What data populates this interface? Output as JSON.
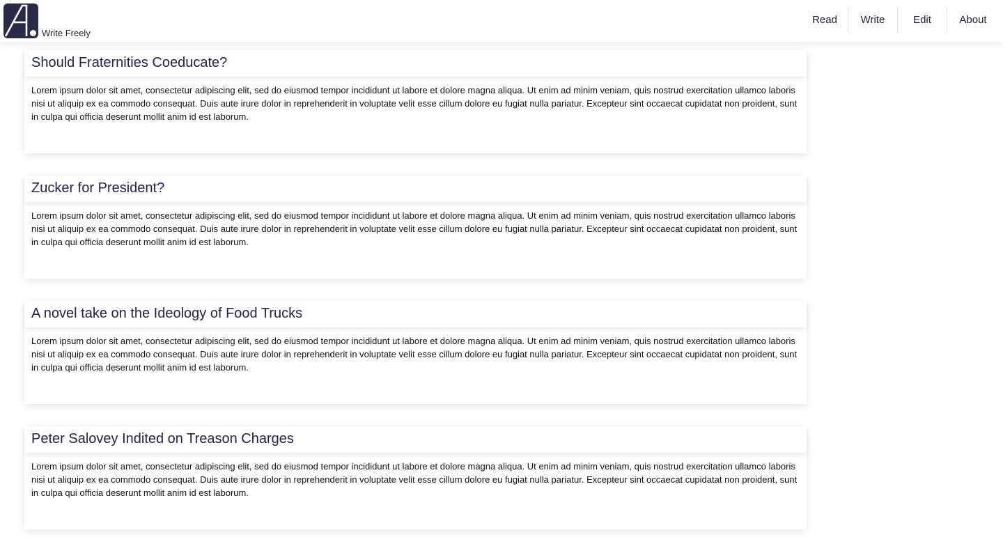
{
  "header": {
    "brand_name": "Write Freely",
    "logo_icon": "write-freely-logo-icon",
    "logo_color": "#2a2b4a",
    "nav": [
      {
        "label": "Read"
      },
      {
        "label": "Write"
      },
      {
        "label": "Edit"
      },
      {
        "label": "About"
      }
    ]
  },
  "posts": [
    {
      "title": "Should Fraternities Coeducate?",
      "body": "Lorem ipsum dolor sit amet, consectetur adipiscing elit, sed do eiusmod tempor incididunt ut labore et dolore magna aliqua. Ut enim ad minim veniam, quis nostrud exercitation ullamco laboris nisi ut aliquip ex ea commodo consequat. Duis aute irure dolor in reprehenderit in voluptate velit esse cillum dolore eu fugiat nulla pariatur. Excepteur sint occaecat cupidatat non proident, sunt in culpa qui officia deserunt mollit anim id est laborum."
    },
    {
      "title": "Zucker for President?",
      "body": "Lorem ipsum dolor sit amet, consectetur adipiscing elit, sed do eiusmod tempor incididunt ut labore et dolore magna aliqua. Ut enim ad minim veniam, quis nostrud exercitation ullamco laboris nisi ut aliquip ex ea commodo consequat. Duis aute irure dolor in reprehenderit in voluptate velit esse cillum dolore eu fugiat nulla pariatur. Excepteur sint occaecat cupidatat non proident, sunt in culpa qui officia deserunt mollit anim id est laborum."
    },
    {
      "title": "A novel take on the Ideology of Food Trucks",
      "body": "Lorem ipsum dolor sit amet, consectetur adipiscing elit, sed do eiusmod tempor incididunt ut labore et dolore magna aliqua. Ut enim ad minim veniam, quis nostrud exercitation ullamco laboris nisi ut aliquip ex ea commodo consequat. Duis aute irure dolor in reprehenderit in voluptate velit esse cillum dolore eu fugiat nulla pariatur. Excepteur sint occaecat cupidatat non proident, sunt in culpa qui officia deserunt mollit anim id est laborum."
    },
    {
      "title": "Peter Salovey Indited on Treason Charges",
      "body": "Lorem ipsum dolor sit amet, consectetur adipiscing elit, sed do eiusmod tempor incididunt ut labore et dolore magna aliqua. Ut enim ad minim veniam, quis nostrud exercitation ullamco laboris nisi ut aliquip ex ea commodo consequat. Duis aute irure dolor in reprehenderit in voluptate velit esse cillum dolore eu fugiat nulla pariatur. Excepteur sint occaecat cupidatat non proident, sunt in culpa qui officia deserunt mollit anim id est laborum."
    }
  ]
}
